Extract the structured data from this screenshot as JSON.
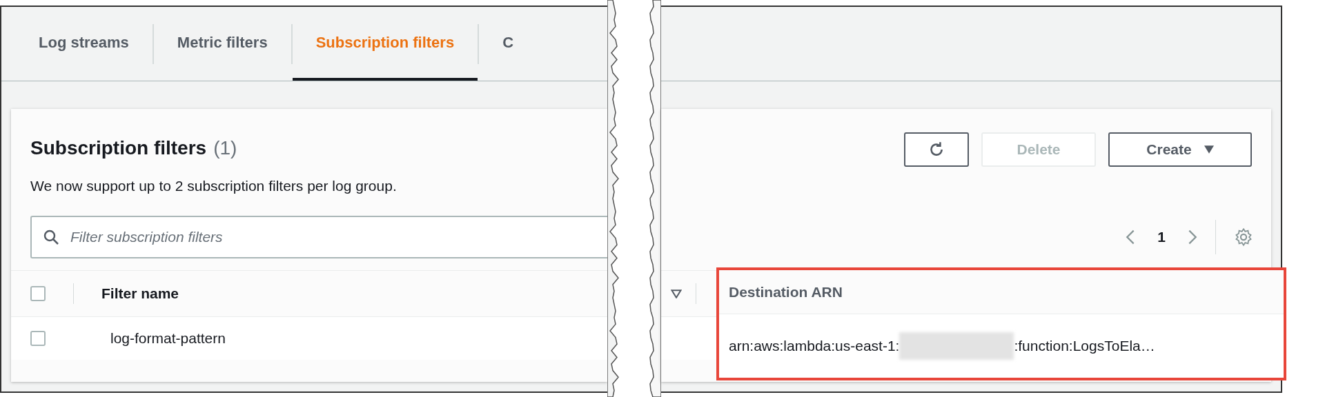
{
  "tabs": [
    {
      "label": "Log streams",
      "selected": false
    },
    {
      "label": "Metric filters",
      "selected": false
    },
    {
      "label": "Subscription filters",
      "selected": true
    },
    {
      "label": "C",
      "selected": false
    }
  ],
  "panel": {
    "title": "Subscription filters",
    "count": "(1)",
    "description": "We now support up to 2 subscription filters per log group.",
    "buttons": [
      {
        "kind": "refresh",
        "disabled": false
      },
      {
        "kind": "text",
        "label": "Delete",
        "disabled": true
      },
      {
        "kind": "menu",
        "label": "Create",
        "disabled": false
      }
    ],
    "search": {
      "placeholder": "Filter subscription filters"
    },
    "pagination": {
      "page": "1"
    }
  },
  "table": {
    "select_all": {
      "checked": false
    },
    "columns": [
      {
        "label": "Filter name",
        "highlighted": false
      },
      {
        "label": "Destination ARN",
        "highlighted": true
      }
    ],
    "rows": [
      {
        "checked": false,
        "filter_name": "log-format-pattern",
        "destination_arn": {
          "before": "arn:aws:lambda:us-east-1:",
          "redacted": true,
          "after": ":function:LogsToEla…"
        }
      }
    ]
  }
}
